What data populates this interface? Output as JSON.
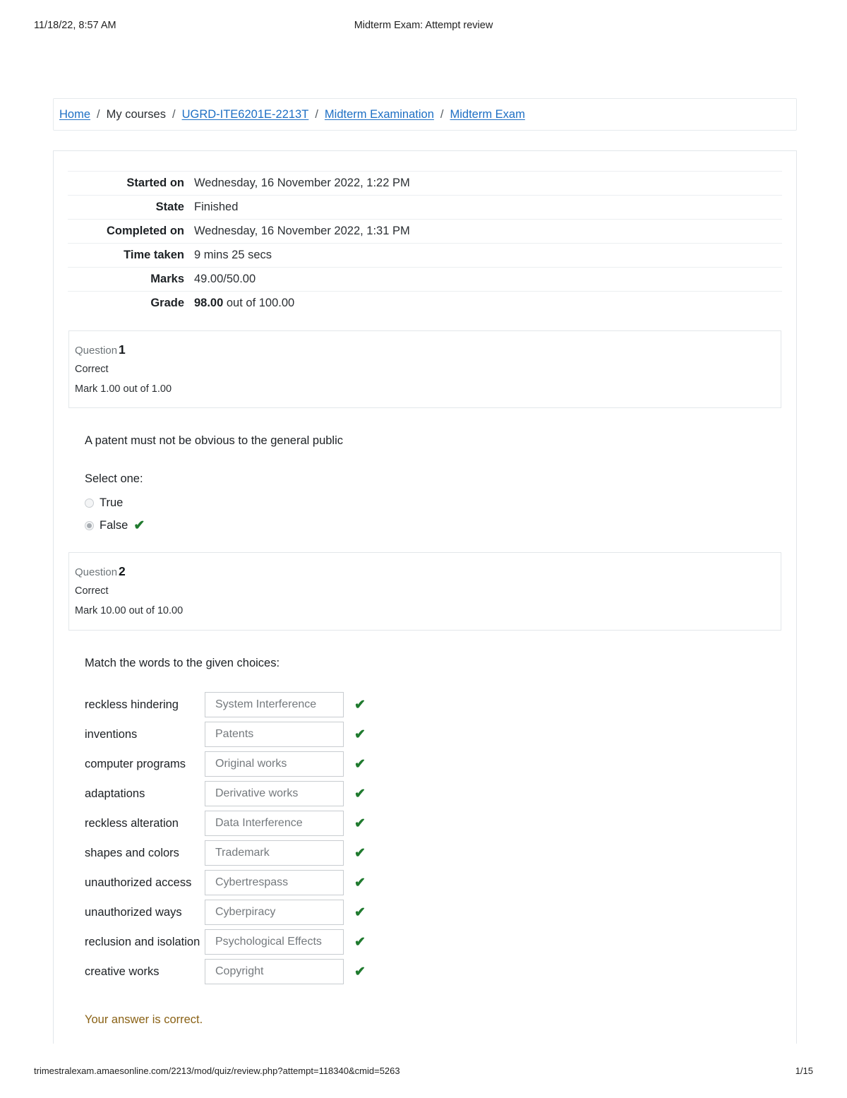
{
  "print_header": {
    "date": "11/18/22, 8:57 AM",
    "title": "Midterm Exam: Attempt review"
  },
  "print_footer": {
    "url": "trimestralexam.amaesonline.com/2213/mod/quiz/review.php?attempt=118340&cmid=5263",
    "page": "1/15"
  },
  "breadcrumb": {
    "items": [
      {
        "label": "Home",
        "link": true
      },
      {
        "label": "My courses",
        "link": false
      },
      {
        "label": "UGRD-ITE6201E-2213T",
        "link": true
      },
      {
        "label": "Midterm Examination",
        "link": true
      },
      {
        "label": "Midterm Exam",
        "link": true
      }
    ],
    "separator": "/"
  },
  "summary": {
    "rows": [
      {
        "label": "Started on",
        "value": "Wednesday, 16 November 2022, 1:22 PM"
      },
      {
        "label": "State",
        "value": "Finished"
      },
      {
        "label": "Completed on",
        "value": "Wednesday, 16 November 2022, 1:31 PM"
      },
      {
        "label": "Time taken",
        "value": "9 mins 25 secs"
      },
      {
        "label": "Marks",
        "value": "49.00/50.00"
      }
    ],
    "grade": {
      "label": "Grade",
      "number": "98.00",
      "suffix": " out of 100.00"
    }
  },
  "questions": [
    {
      "number_label": "Question",
      "number": "1",
      "state": "Correct",
      "mark": "Mark 1.00 out of 1.00",
      "text": "A patent must not be obvious to the general public",
      "select_one_label": "Select one:",
      "options": [
        {
          "label": "True",
          "selected": false,
          "correct": false
        },
        {
          "label": "False",
          "selected": true,
          "correct": true
        }
      ]
    },
    {
      "number_label": "Question",
      "number": "2",
      "state": "Correct",
      "mark": "Mark 10.00 out of 10.00",
      "text": "Match the words to the given choices:",
      "pairs": [
        {
          "term": "reckless hindering",
          "answer": "System Interference",
          "correct": true
        },
        {
          "term": "inventions",
          "answer": "Patents",
          "correct": true
        },
        {
          "term": "computer programs",
          "answer": "Original works",
          "correct": true
        },
        {
          "term": "adaptations",
          "answer": "Derivative works",
          "correct": true
        },
        {
          "term": "reckless alteration",
          "answer": "Data Interference",
          "correct": true
        },
        {
          "term": "shapes and colors",
          "answer": "Trademark",
          "correct": true
        },
        {
          "term": "unauthorized access",
          "answer": "Cybertrespass",
          "correct": true
        },
        {
          "term": "unauthorized ways",
          "answer": "Cyberpiracy",
          "correct": true
        },
        {
          "term": "reclusion and isolation",
          "answer": "Psychological Effects",
          "correct": true
        },
        {
          "term": "creative works",
          "answer": "Copyright",
          "correct": true
        }
      ],
      "feedback": "Your answer is correct."
    }
  ],
  "icons": {
    "check": "✔"
  },
  "colors": {
    "link": "#1d6fc4",
    "correct_green": "#1f7a2e",
    "feedback_amber": "#8a6216"
  }
}
